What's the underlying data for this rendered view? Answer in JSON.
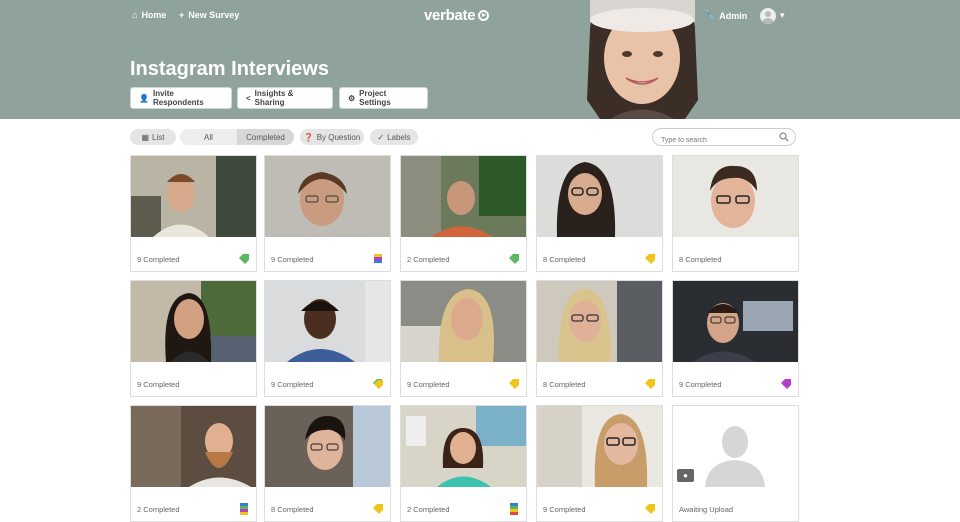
{
  "nav": {
    "home": "Home",
    "new_survey": "New Survey",
    "logo": "verbate",
    "admin": "Admin"
  },
  "page": {
    "title": "Instagram Interviews"
  },
  "header_buttons": {
    "invite": "Invite Respondents",
    "insights": "Insights & Sharing",
    "settings": "Project Settings"
  },
  "filters": {
    "list": "List",
    "all": "All",
    "completed": "Completed",
    "by_question": "By Question",
    "labels": "Labels",
    "search_placeholder": "Type to search"
  },
  "colors": {
    "header_bg": "#8fa39c",
    "tag_green": "#5cb85c",
    "tag_yellow": "#f0c419",
    "tag_purple": "#b23fc6",
    "tag_blue": "#3a7bd5",
    "tag_red": "#e04b3a"
  },
  "cards": [
    {
      "label": "9 Completed",
      "tag": "green"
    },
    {
      "label": "9 Completed",
      "tag": "stack"
    },
    {
      "label": "2 Completed",
      "tag": "green"
    },
    {
      "label": "8 Completed",
      "tag": "yellow"
    },
    {
      "label": "8 Completed",
      "tag": "none"
    },
    {
      "label": "9 Completed",
      "tag": "none"
    },
    {
      "label": "9 Completed",
      "tag": "yellow-green"
    },
    {
      "label": "9 Completed",
      "tag": "yellow"
    },
    {
      "label": "8 Completed",
      "tag": "yellow"
    },
    {
      "label": "9 Completed",
      "tag": "purple"
    },
    {
      "label": "2 Completed",
      "tag": "stack"
    },
    {
      "label": "8 Completed",
      "tag": "yellow"
    },
    {
      "label": "2 Completed",
      "tag": "stack"
    },
    {
      "label": "9 Completed",
      "tag": "yellow"
    },
    {
      "label": "Awaiting Upload",
      "tag": "none"
    }
  ]
}
